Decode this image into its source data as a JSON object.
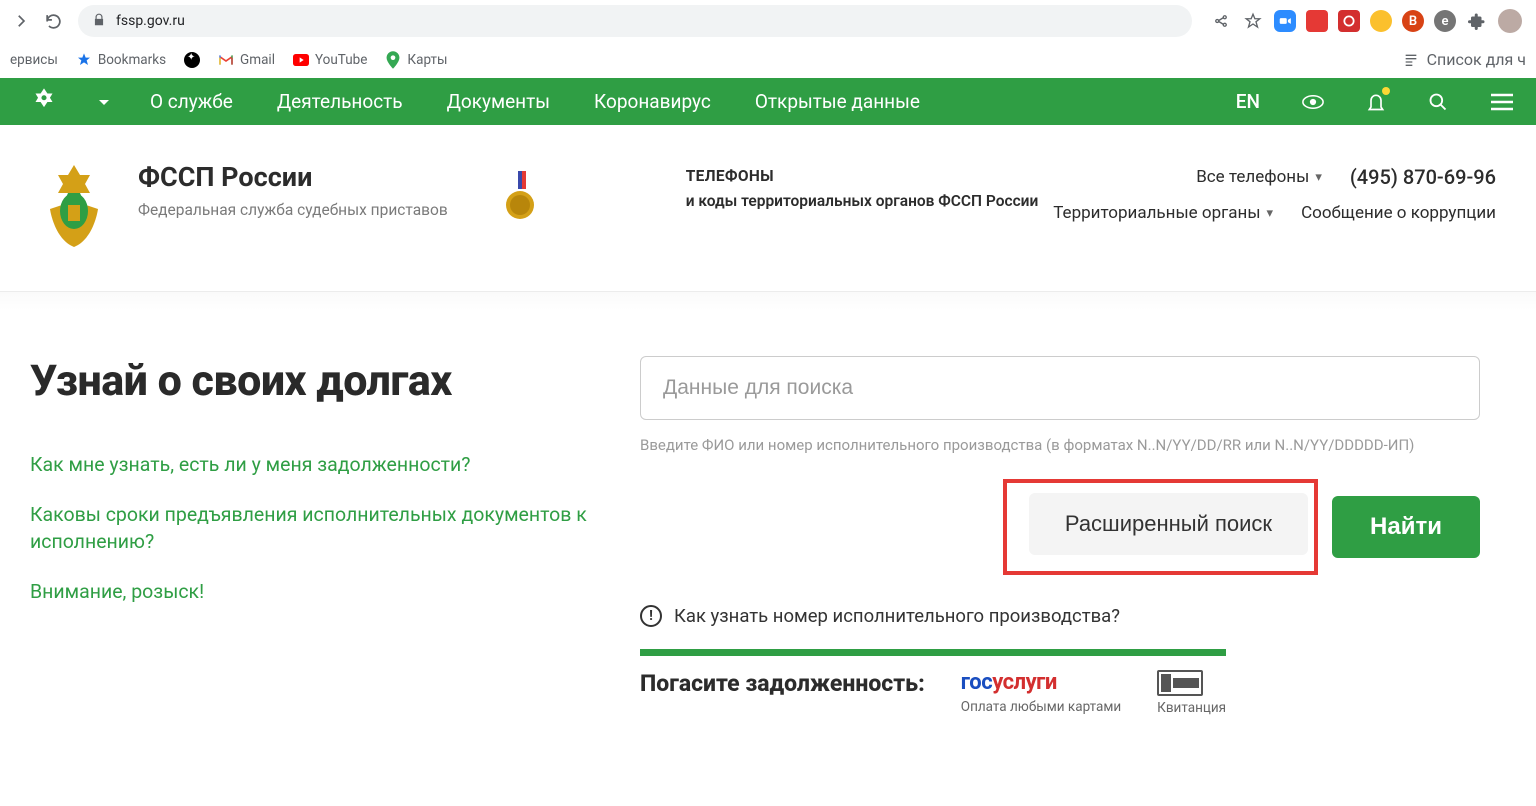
{
  "browser": {
    "url": "fssp.gov.ru"
  },
  "bookmarks": {
    "services": "ервисы",
    "bookmarks": "Bookmarks",
    "gmail": "Gmail",
    "youtube": "YouTube",
    "maps": "Карты",
    "reading_list": "Список для ч"
  },
  "nav": {
    "about": "О службе",
    "activity": "Деятельность",
    "documents": "Документы",
    "covid": "Коронавирус",
    "open_data": "Открытые данные",
    "lang": "EN"
  },
  "header": {
    "title": "ФССП России",
    "subtitle": "Федеральная служба судебных приставов",
    "phones_title": "ТЕЛЕФОНЫ",
    "phones_sub": "и коды территориальных органов ФССП России",
    "all_phones": "Все телефоны",
    "phone_number": "(495) 870-69-96",
    "territorial": "Территориальные органы",
    "corruption": "Сообщение о коррупции"
  },
  "hero": {
    "heading": "Узнай о своих долгах",
    "faq1": "Как мне узнать, есть ли у меня задолженности?",
    "faq2": "Каковы сроки предъявления исполнительных документов к исполнению?",
    "faq3": "Внимание, розыск!",
    "placeholder": "Данные для поиска",
    "hint": "Введите ФИО или номер исполнительного производства (в форматах N..N/YY/DD/RR или N..N/YY/DDDDD-ИП)",
    "advanced": "Расширенный поиск",
    "find": "Найти",
    "how_know": "Как узнать номер исполнительного производства?"
  },
  "payoff": {
    "title": "Погасите задолженность:",
    "gosuslugi_caption": "Оплата любыми картами",
    "receipt": "Квитанция"
  }
}
